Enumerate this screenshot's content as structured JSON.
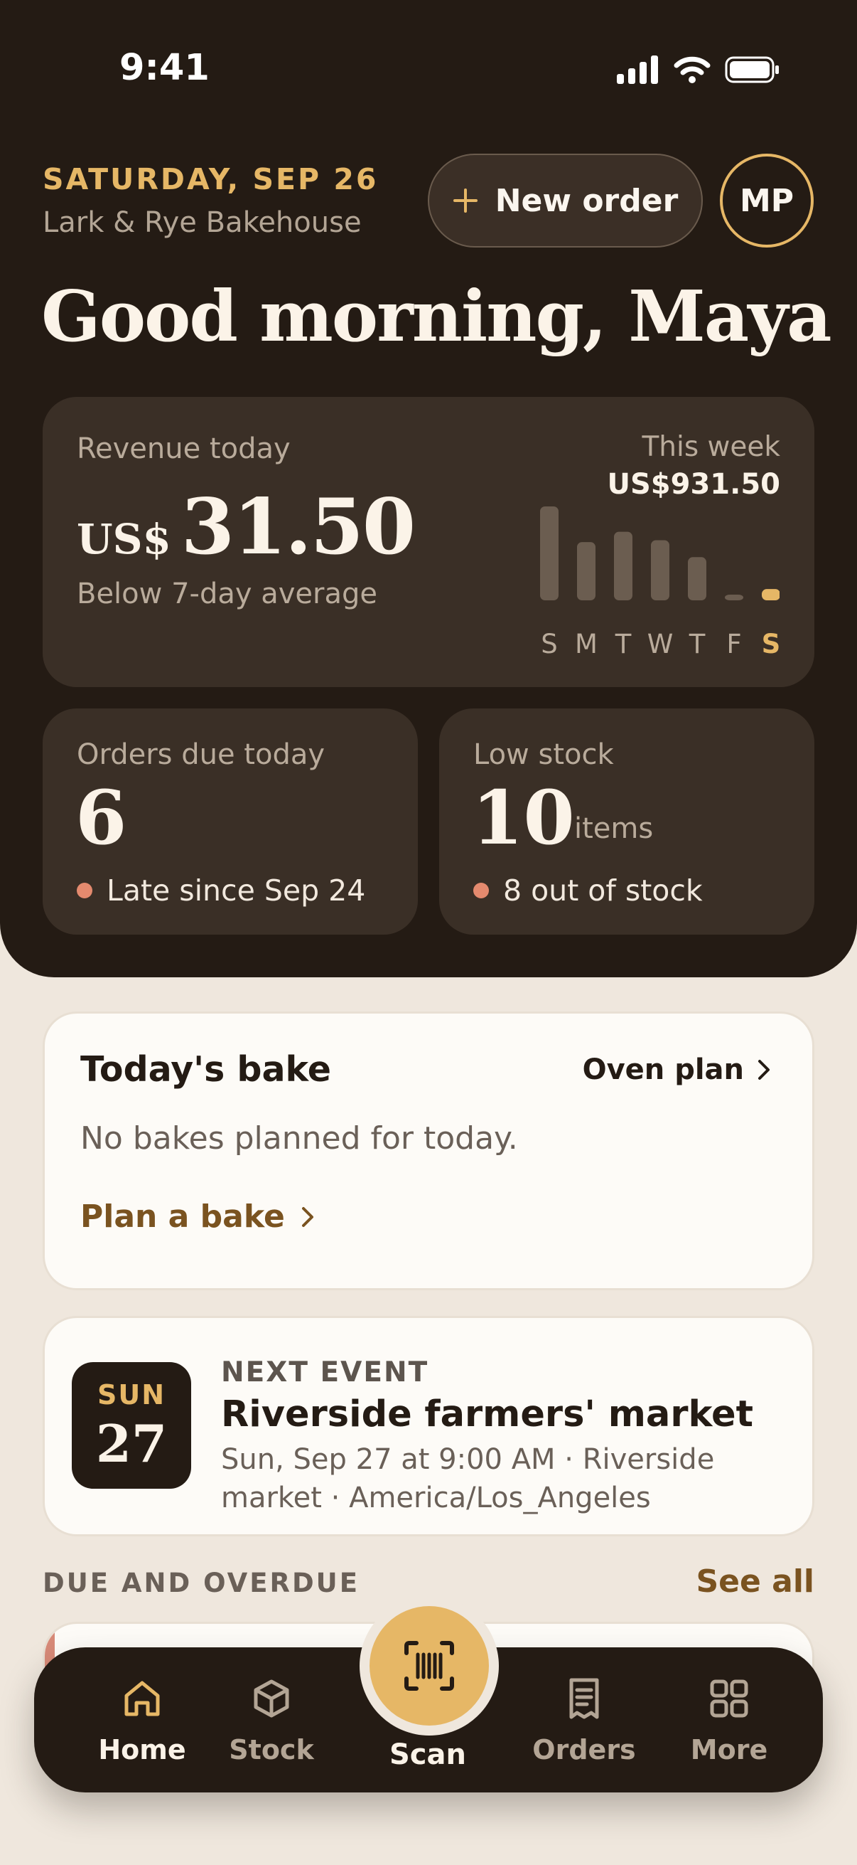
{
  "status_bar": {
    "time": "9:41"
  },
  "header": {
    "date": "SATURDAY, SEP 26",
    "business": "Lark & Rye Bakehouse",
    "new_order_label": "New order",
    "avatar_initials": "MP",
    "greeting": "Good morning, Maya"
  },
  "revenue": {
    "label": "Revenue today",
    "currency": "US$",
    "amount": "31.50",
    "note": "Below 7-day average",
    "week_label": "This week",
    "week_value": "US$931.50"
  },
  "chart_data": {
    "type": "bar",
    "categories": [
      "S",
      "M",
      "T",
      "W",
      "T",
      "F",
      "S"
    ],
    "values": [
      1.0,
      0.62,
      0.73,
      0.64,
      0.46,
      0.06,
      0.12
    ],
    "highlight_index": 6,
    "bar_color": "#6b5d50",
    "highlight_color": "#e6b766"
  },
  "orders_due": {
    "label": "Orders due today",
    "value": "6",
    "note": "Late since Sep 24"
  },
  "low_stock": {
    "label": "Low stock",
    "value": "10",
    "unit": "items",
    "note": "8 out of stock"
  },
  "bake": {
    "title": "Today's bake",
    "link_label": "Oven plan",
    "empty_text": "No bakes planned for today.",
    "action_label": "Plan a bake"
  },
  "event": {
    "day": "SUN",
    "date_num": "27",
    "kicker": "NEXT EVENT",
    "title": "Riverside farmers' market",
    "detail": "Sun, Sep 27 at 9:00 AM · Riverside market · America/Los_Angeles"
  },
  "due_section": {
    "title": "DUE AND OVERDUE",
    "see_all": "See all"
  },
  "tabs": [
    {
      "label": "Home",
      "icon": "home-icon",
      "active": true
    },
    {
      "label": "Stock",
      "icon": "box-icon",
      "active": false
    },
    {
      "label": "Scan",
      "icon": "barcode-icon",
      "active": false
    },
    {
      "label": "Orders",
      "icon": "receipt-icon",
      "active": false
    },
    {
      "label": "More",
      "icon": "grid-icon",
      "active": false
    }
  ],
  "colors": {
    "dark_bg": "#241b14",
    "card_dark": "#3a2f26",
    "accent": "#e6b766",
    "page_bg": "#efe7dd",
    "alert_dot": "#e48a6e",
    "link": "#7a5320"
  }
}
